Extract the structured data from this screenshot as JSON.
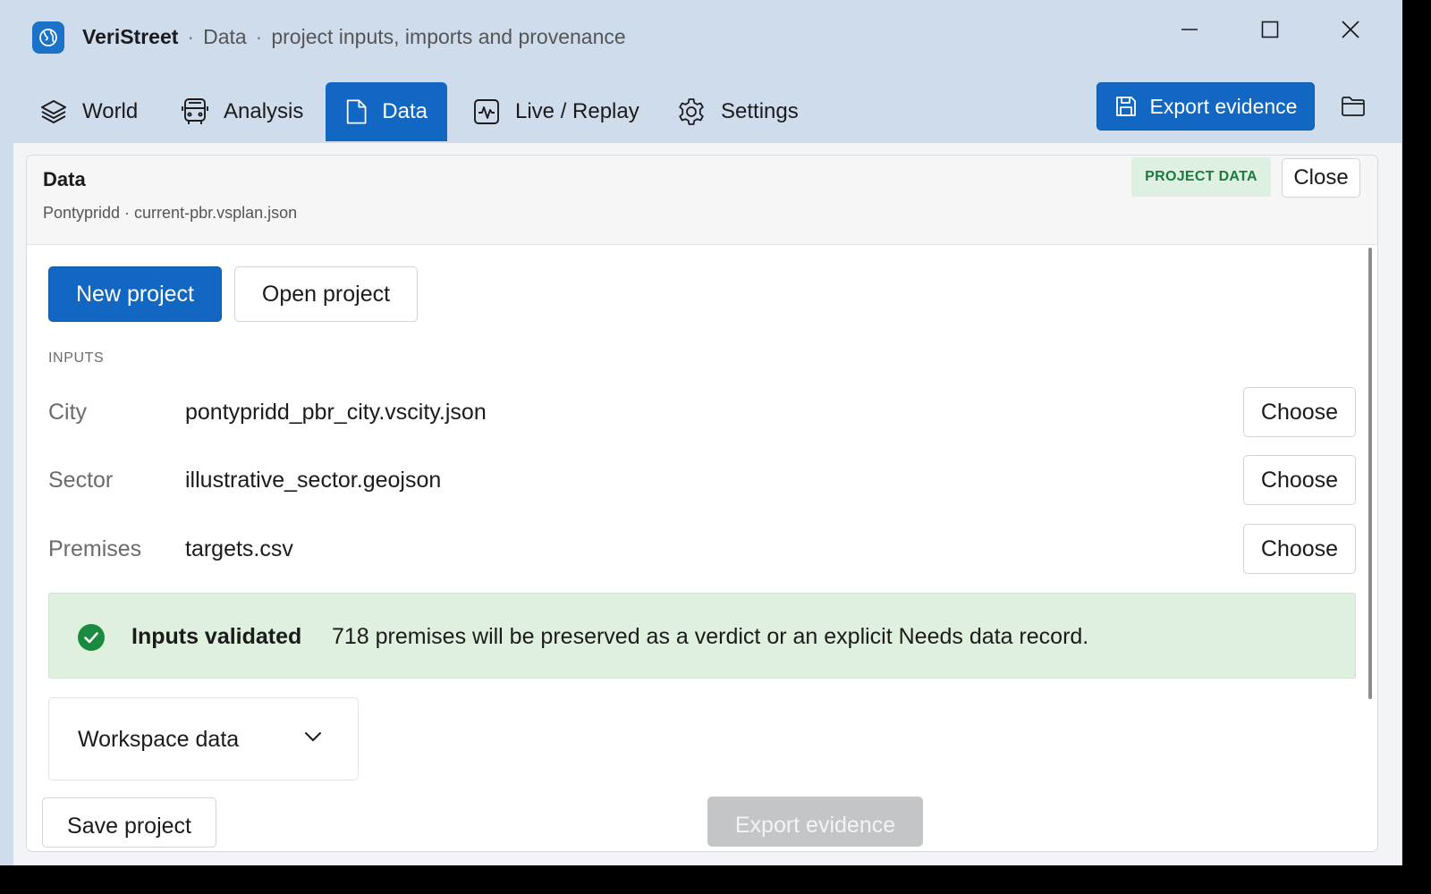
{
  "window": {
    "app_name": "VeriStreet",
    "section": "Data",
    "subtitle": "project inputs, imports and provenance",
    "separator": "·",
    "icons": {
      "app": "globe-icon",
      "minimize": "minimize-icon",
      "maximize": "maximize-icon",
      "close": "close-icon"
    }
  },
  "tabs": [
    {
      "label": "World",
      "icon": "layers-icon",
      "active": false
    },
    {
      "label": "Analysis",
      "icon": "bus-icon",
      "active": false
    },
    {
      "label": "Data",
      "icon": "document-icon",
      "active": true
    },
    {
      "label": "Live / Replay",
      "icon": "pulse-icon",
      "active": false
    },
    {
      "label": "Settings",
      "icon": "gear-icon",
      "active": false
    }
  ],
  "toolbar": {
    "export_label": "Export evidence",
    "export_icon": "save-icon",
    "folder_icon": "folder-icon"
  },
  "panel": {
    "title": "Data",
    "subtitle": "Pontypridd · current-pbr.vsplan.json",
    "badge": "PROJECT DATA",
    "close_label": "Close",
    "new_project_label": "New project",
    "open_project_label": "Open project",
    "inputs_heading": "INPUTS",
    "inputs": [
      {
        "label": "City",
        "value": "pontypridd_pbr_city.vscity.json",
        "action": "Choose"
      },
      {
        "label": "Sector",
        "value": "illustrative_sector.geojson",
        "action": "Choose"
      },
      {
        "label": "Premises",
        "value": "targets.csv",
        "action": "Choose"
      }
    ],
    "validation": {
      "title": "Inputs validated",
      "message": "718 premises will be preserved as a verdict or an explicit Needs data record.",
      "icon": "check-circle-icon",
      "color": "#1a8a3f"
    },
    "workspace_label": "Workspace data",
    "save_label": "Save project",
    "export_label": "Export evidence"
  },
  "colors": {
    "accent": "#1167c2",
    "success_bg": "#dff1de",
    "badge_text": "#1b7a3d",
    "titlebar_bg": "#cfdcec"
  }
}
